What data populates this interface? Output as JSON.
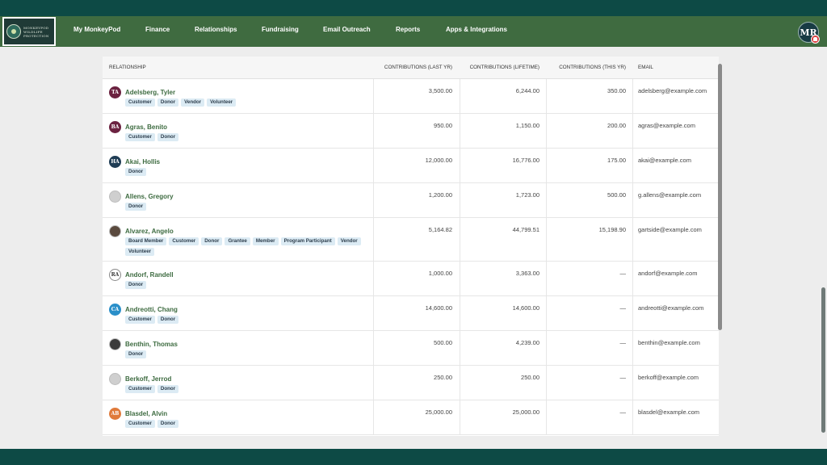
{
  "nav": {
    "logo_text": "MONKEYPOD WILDLIFE PROTECTION",
    "items": [
      "My MonkeyPod",
      "Finance",
      "Relationships",
      "Fundraising",
      "Email Outreach",
      "Reports",
      "Apps & Integrations"
    ],
    "user_initials": "MR"
  },
  "table": {
    "headers": {
      "relationship": "RELATIONSHIP",
      "last_yr": "CONTRIBUTIONS (LAST YR)",
      "lifetime": "CONTRIBUTIONS (LIFETIME)",
      "this_yr": "CONTRIBUTIONS (THIS YR)",
      "email": "EMAIL"
    },
    "rows": [
      {
        "initials": "TA",
        "avatar_color": "#6b2240",
        "name": "Adelsberg, Tyler",
        "tags": [
          "Customer",
          "Donor",
          "Vendor",
          "Volunteer"
        ],
        "last_yr": "3,500.00",
        "lifetime": "6,244.00",
        "this_yr": "350.00",
        "email": "adelsberg@example.com"
      },
      {
        "initials": "BA",
        "avatar_color": "#6b2240",
        "name": "Agras, Benito",
        "tags": [
          "Customer",
          "Donor"
        ],
        "last_yr": "950.00",
        "lifetime": "1,150.00",
        "this_yr": "200.00",
        "email": "agras@example.com"
      },
      {
        "initials": "HA",
        "avatar_color": "#1f3d55",
        "name": "Akai, Hollis",
        "tags": [
          "Donor"
        ],
        "last_yr": "12,000.00",
        "lifetime": "16,776.00",
        "this_yr": "175.00",
        "email": "akai@example.com"
      },
      {
        "initials": "",
        "avatar_color": "#cfcfcf",
        "name": "Allens, Gregory",
        "tags": [
          "Donor"
        ],
        "last_yr": "1,200.00",
        "lifetime": "1,723.00",
        "this_yr": "500.00",
        "email": "g.allens@example.com"
      },
      {
        "initials": "",
        "avatar_color": "#5a4a3e",
        "name": "Alvarez, Angelo",
        "tags": [
          "Board Member",
          "Customer",
          "Donor",
          "Grantee",
          "Member",
          "Program Participant",
          "Vendor",
          "Volunteer"
        ],
        "last_yr": "5,164.82",
        "lifetime": "44,799.51",
        "this_yr": "15,198.90",
        "email": "gartside@example.com"
      },
      {
        "initials": "RA",
        "avatar_color": "#ffffff",
        "name": "Andorf, Randell",
        "tags": [
          "Donor"
        ],
        "last_yr": "1,000.00",
        "lifetime": "3,363.00",
        "this_yr": "—",
        "email": "andorf@example.com"
      },
      {
        "initials": "CA",
        "avatar_color": "#2a8fc9",
        "name": "Andreotti, Chang",
        "tags": [
          "Customer",
          "Donor"
        ],
        "last_yr": "14,600.00",
        "lifetime": "14,600.00",
        "this_yr": "—",
        "email": "andreotti@example.com"
      },
      {
        "initials": "",
        "avatar_color": "#3b3b3b",
        "name": "Benthin, Thomas",
        "tags": [
          "Donor"
        ],
        "last_yr": "500.00",
        "lifetime": "4,239.00",
        "this_yr": "—",
        "email": "benthin@example.com"
      },
      {
        "initials": "",
        "avatar_color": "#cfcfcf",
        "name": "Berkoff, Jerrod",
        "tags": [
          "Customer",
          "Donor"
        ],
        "last_yr": "250.00",
        "lifetime": "250.00",
        "this_yr": "—",
        "email": "berkoff@example.com"
      },
      {
        "initials": "AB",
        "avatar_color": "#e07a3a",
        "name": "Blasdel, Alvin",
        "tags": [
          "Customer",
          "Donor"
        ],
        "last_yr": "25,000.00",
        "lifetime": "25,000.00",
        "this_yr": "—",
        "email": "blasdel@example.com"
      }
    ]
  }
}
